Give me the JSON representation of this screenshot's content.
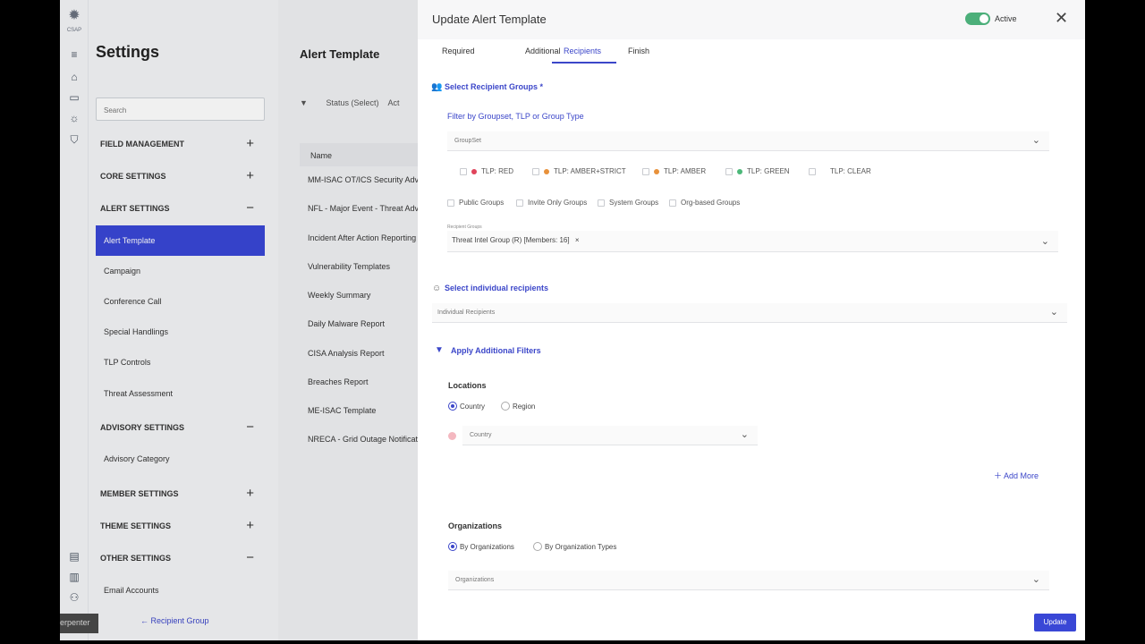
{
  "app": {
    "logo_text": "CSAP",
    "logo_icon": "gear-logo-icon"
  },
  "rail": {
    "icons": [
      "menu-icon",
      "home-icon",
      "message-icon",
      "sun-icon",
      "shield-icon",
      "document-icon",
      "building-icon",
      "users-icon"
    ]
  },
  "settings": {
    "title": "Settings",
    "search_placeholder": "Search",
    "sections": [
      {
        "label": "FIELD MANAGEMENT",
        "toggle": "+"
      },
      {
        "label": "CORE SETTINGS",
        "toggle": "+"
      },
      {
        "label": "ALERT SETTINGS",
        "toggle": "−"
      },
      {
        "label": "ADVISORY SETTINGS",
        "toggle": "−"
      },
      {
        "label": "MEMBER SETTINGS",
        "toggle": "+"
      },
      {
        "label": "THEME SETTINGS",
        "toggle": "+"
      },
      {
        "label": "OTHER SETTINGS",
        "toggle": "−"
      }
    ],
    "alert_items": [
      "Alert Template",
      "Campaign",
      "Conference Call",
      "Special Handlings",
      "TLP Controls",
      "Threat Assessment"
    ],
    "advisory_items": [
      "Advisory Category"
    ],
    "other_items": [
      "Email Accounts"
    ],
    "user_label": "erpenter",
    "back_link": "Recipient Group"
  },
  "middle": {
    "title": "Alert Template",
    "filter_label": "Status (Select)",
    "filter_extra": "Act",
    "column_header": "Name",
    "templates": [
      "MM-ISAC OT/ICS Security Advi",
      "NFL - Major Event - Threat Advi",
      "Incident After Action Reporting",
      "Vulnerability Templates",
      "Weekly Summary",
      "Daily Malware Report",
      "CISA Analysis Report",
      "Breaches Report",
      "ME-ISAC Template",
      "NRECA - Grid Outage Notificati"
    ]
  },
  "drawer": {
    "title": "Update Alert Template",
    "active_label": "Active",
    "active": true,
    "tabs": [
      "Required",
      "Additional",
      "Recipients",
      "Finish"
    ],
    "active_tab": "Recipients",
    "recipient_groups_title": "Select Recipient Groups *",
    "filter_label": "Filter by Groupset, TLP or Group Type",
    "groupset_placeholder": "GroupSet",
    "tlp": [
      {
        "label": "TLP: RED",
        "color": "#e0435b"
      },
      {
        "label": "TLP: AMBER+STRICT",
        "color": "#e8913a"
      },
      {
        "label": "TLP: AMBER",
        "color": "#e8913a"
      },
      {
        "label": "TLP: GREEN",
        "color": "#4cb879"
      },
      {
        "label": "TLP: CLEAR",
        "color": "#ffffff"
      }
    ],
    "group_types": [
      "Public Groups",
      "Invite Only Groups",
      "System Groups",
      "Org-based Groups"
    ],
    "recipient_groups_label": "Recipient Groups",
    "selected_group": "Threat Intel Group (R) [Members: 16]",
    "individual_title": "Select individual recipients",
    "individual_placeholder": "Individual Recipients",
    "filters_title": "Apply Additional Filters",
    "locations_heading": "Locations",
    "location_options": [
      "Country",
      "Region"
    ],
    "location_selected": "Country",
    "country_placeholder": "Country",
    "add_more": "Add More",
    "organizations_heading": "Organizations",
    "org_options": [
      "By Organizations",
      "By Organization Types"
    ],
    "org_selected": "By Organizations",
    "organizations_placeholder": "Organizations",
    "update_label": "Update"
  },
  "colors": {
    "accent": "#3947d6",
    "toggle_on": "#4caf7a"
  }
}
